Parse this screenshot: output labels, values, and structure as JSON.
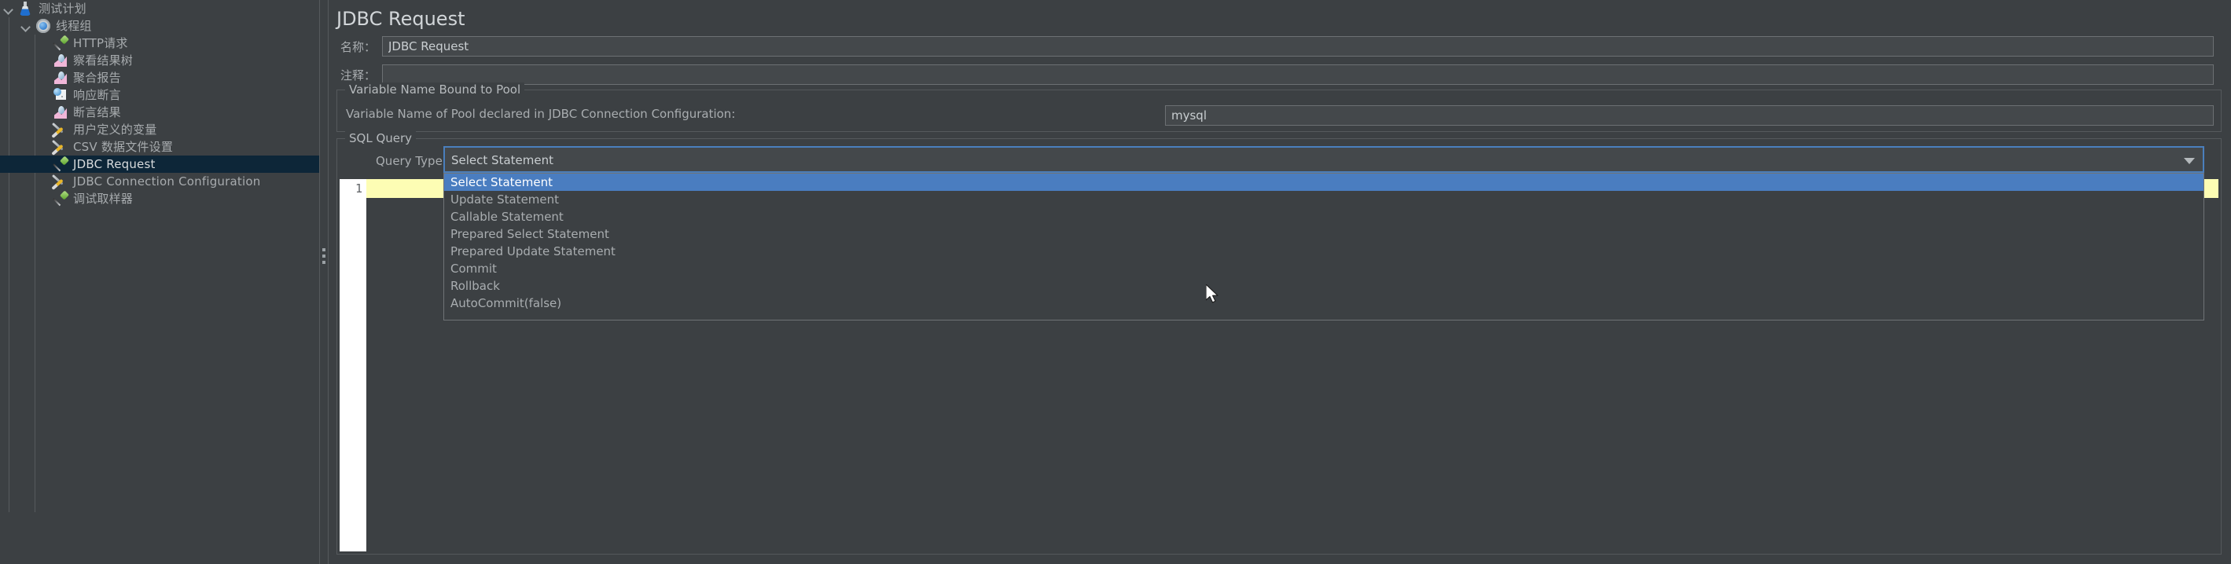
{
  "tree": {
    "items": [
      {
        "label": "测试计划",
        "icon": "flask-icon",
        "depth": 0,
        "twisty": "expanded",
        "selected": false
      },
      {
        "label": "线程组",
        "icon": "gear-icon",
        "depth": 1,
        "twisty": "expanded",
        "selected": false
      },
      {
        "label": "HTTP请求",
        "icon": "pipette-icon",
        "depth": 2,
        "twisty": "none",
        "selected": false
      },
      {
        "label": "察看结果树",
        "icon": "chart-icon",
        "depth": 2,
        "twisty": "none",
        "selected": false
      },
      {
        "label": "聚合报告",
        "icon": "chart-icon",
        "depth": 2,
        "twisty": "none",
        "selected": false
      },
      {
        "label": "响应断言",
        "icon": "magnify-icon",
        "depth": 2,
        "twisty": "none",
        "selected": false
      },
      {
        "label": "断言结果",
        "icon": "chart-icon",
        "depth": 2,
        "twisty": "none",
        "selected": false
      },
      {
        "label": "用户定义的变量",
        "icon": "wrench-icon",
        "depth": 2,
        "twisty": "none",
        "selected": false
      },
      {
        "label": "CSV 数据文件设置",
        "icon": "wrench-icon",
        "depth": 2,
        "twisty": "none",
        "selected": false
      },
      {
        "label": "JDBC Request",
        "icon": "pipette-icon",
        "depth": 2,
        "twisty": "none",
        "selected": true
      },
      {
        "label": "JDBC Connection Configuration",
        "icon": "wrench-icon",
        "depth": 2,
        "twisty": "none",
        "selected": false
      },
      {
        "label": "调试取样器",
        "icon": "pipette-icon",
        "depth": 2,
        "twisty": "none",
        "selected": false
      }
    ]
  },
  "panel": {
    "title": "JDBC Request",
    "name_label": "名称：",
    "name_value": "JDBC Request",
    "comment_label": "注释：",
    "comment_value": "",
    "variable_group_title": "Variable Name Bound to Pool",
    "pool_label": "Variable Name of Pool declared in JDBC Connection Configuration:",
    "pool_value": "mysql",
    "sql_group_title": "SQL Query",
    "query_type_label": "Query Type:",
    "query_type_value": "Select Statement",
    "query_type_options": [
      "Select Statement",
      "Update Statement",
      "Callable Statement",
      "Prepared Select Statement",
      "Prepared Update Statement",
      "Commit",
      "Rollback",
      "AutoCommit(false)"
    ],
    "query_type_selected_index": 0,
    "editor_line_number": "1",
    "editor_text": ""
  },
  "colors": {
    "background": "#3c4043",
    "selection_blue": "#4a7dc0",
    "tree_selection": "#0d2638",
    "focus_border": "#4a7fbd",
    "current_line": "#fdfdb4"
  }
}
